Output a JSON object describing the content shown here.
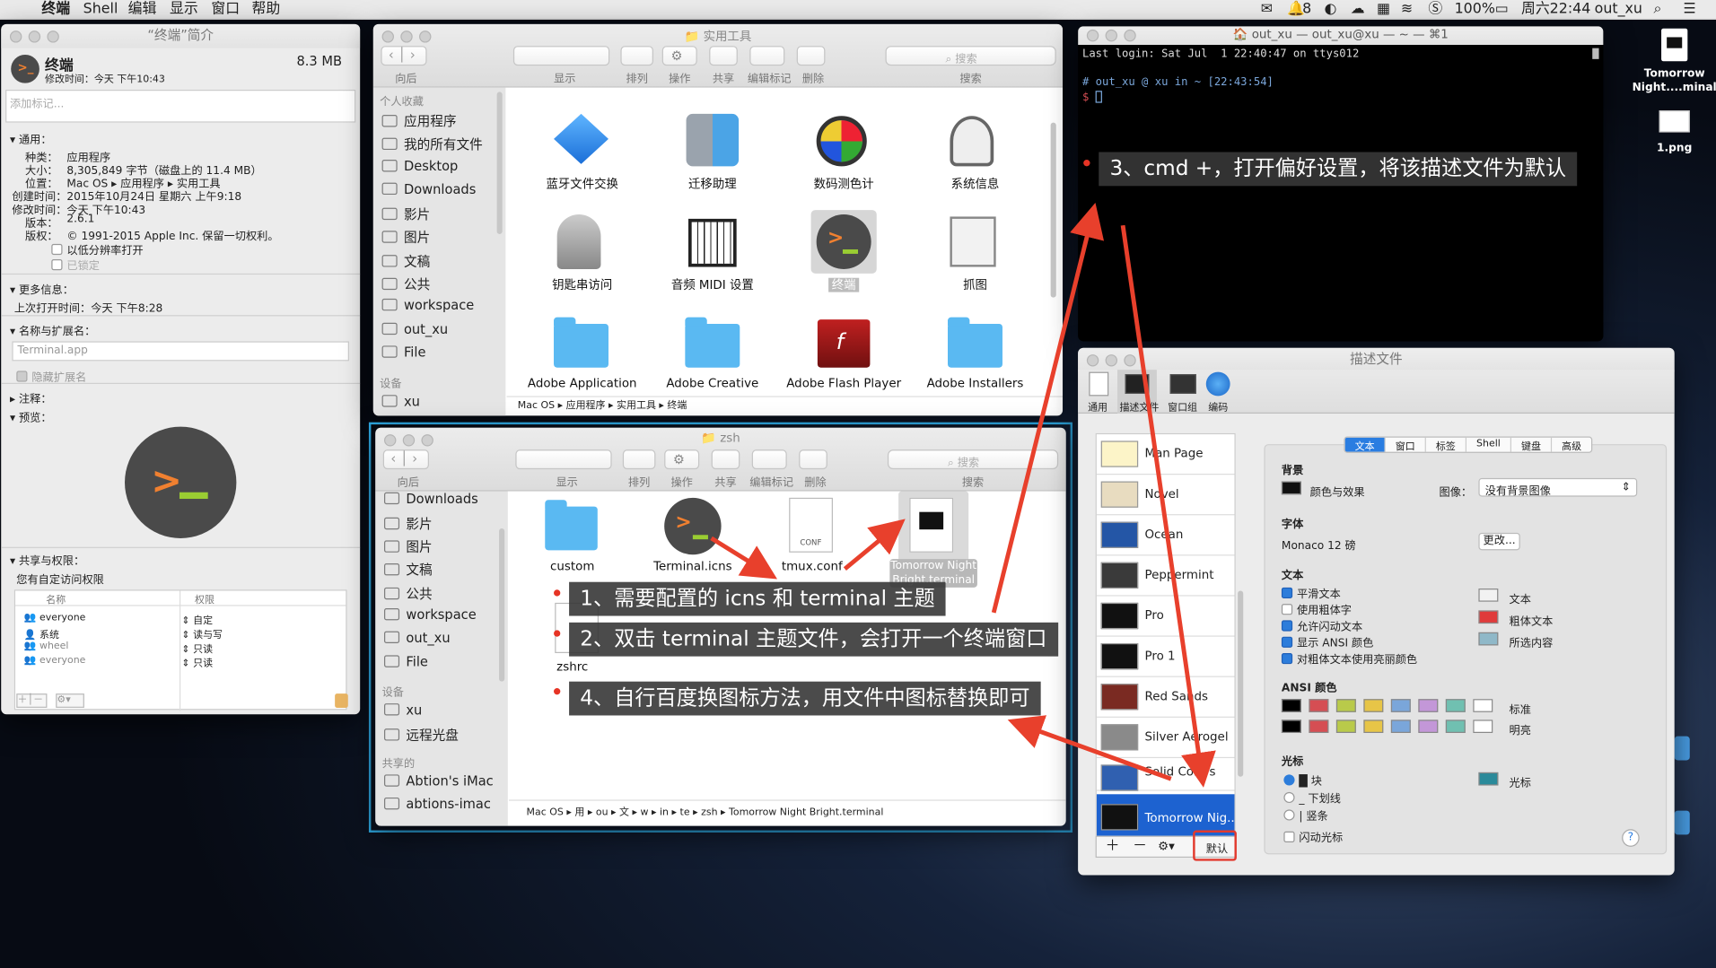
{
  "menubar": {
    "app": "终端",
    "items": [
      "Shell",
      "编辑",
      "显示",
      "窗口",
      "帮助"
    ],
    "wechat_badge": "8",
    "battery": "100%",
    "datetime": "周六22:44",
    "user": "out_xu"
  },
  "desktop": {
    "icons": [
      {
        "label": "Tomorrow Night....minal"
      },
      {
        "label": "1.png"
      }
    ]
  },
  "info": {
    "title": "“终端”简介",
    "name": "终端",
    "size": "8.3 MB",
    "modified": "修改时间：今天 下午10:43",
    "tags_placeholder": "添加标记...",
    "general_hd": "通用：",
    "rows": [
      {
        "k": "种类：",
        "v": "应用程序"
      },
      {
        "k": "大小：",
        "v": "8,305,849 字节（磁盘上的 11.4 MB）"
      },
      {
        "k": "位置：",
        "v": "Mac OS ▸ 应用程序 ▸ 实用工具"
      },
      {
        "k": "创建时间：",
        "v": "2015年10月24日 星期六 上午9:18"
      },
      {
        "k": "修改时间：",
        "v": "今天 下午10:43"
      },
      {
        "k": "版本：",
        "v": "2.6.1"
      },
      {
        "k": "版权：",
        "v": "© 1991-2015 Apple Inc. 保留一切权利。"
      }
    ],
    "lowres": "以低分辨率打开",
    "locked": "已锁定",
    "more_hd": "更多信息：",
    "last_opened": "上次打开时间：今天 下午8:28",
    "name_hd": "名称与扩展名：",
    "filename": "Terminal.app",
    "hide_ext": "隐藏扩展名",
    "comments_hd": "注释：",
    "preview_hd": "预览：",
    "share_hd": "共享与权限：",
    "custom_access": "您有自定访问权限",
    "perm_headers": [
      "名称",
      "权限"
    ],
    "perms": [
      {
        "n": "everyone",
        "p": "自定"
      },
      {
        "n": "系统",
        "p": "读与写"
      },
      {
        "n": "wheel",
        "p": "只读"
      },
      {
        "n": "everyone",
        "p": "只读"
      }
    ]
  },
  "finder_tb": {
    "back": "向后",
    "view": "显示",
    "arrange": "排列",
    "action": "操作",
    "share": "共享",
    "tags": "编辑标记",
    "delete": "删除",
    "search_ph": "搜索",
    "search": "搜索"
  },
  "finder1": {
    "title": "实用工具",
    "sec_fav": "个人收藏",
    "sidebar": [
      "应用程序",
      "我的所有文件",
      "Desktop",
      "Downloads",
      "影片",
      "图片",
      "文稿",
      "公共",
      "workspace",
      "out_xu",
      "File"
    ],
    "sec_dev": "设备",
    "device": "xu",
    "items": [
      "蓝牙文件交换",
      "迁移助理",
      "数码测色计",
      "系统信息",
      "钥匙串访问",
      "音频 MIDI 设置",
      "终端",
      "抓图",
      "Adobe Application",
      "Adobe Creative",
      "Adobe Flash Player",
      "Adobe Installers"
    ],
    "path": [
      "Mac OS",
      "应用程序",
      "实用工具",
      "终端"
    ]
  },
  "finder2": {
    "title": "zsh",
    "sidebar": [
      "Downloads",
      "影片",
      "图片",
      "文稿",
      "公共",
      "workspace",
      "out_xu",
      "File"
    ],
    "sec_dev": "设备",
    "devices": [
      "xu",
      "远程光盘"
    ],
    "sec_shared": "共享的",
    "shared": [
      "Abtion's iMac",
      "abtions-imac"
    ],
    "items": [
      "custom",
      "Terminal.icns",
      "tmux.conf",
      "Tomorrow Night Bright.terminal",
      "zshrc"
    ],
    "conf_badge": "CONF",
    "path": [
      "Mac OS",
      "用",
      "ou",
      "文",
      "w",
      "in",
      "te",
      "zsh",
      "Tomorrow Night Bright.terminal"
    ]
  },
  "terminal": {
    "title": "out_xu — out_xu@xu — ~ — ⌘1",
    "line1": "Last login: Sat Jul  1 22:40:47 on ttys012",
    "line2": "# out_xu @ xu in ~ [22:43:54]",
    "prompt": "$"
  },
  "notes": [
    "1、需要配置的 icns 和 terminal 主题",
    "2、双击 terminal 主题文件，会打开一个终端窗口",
    "3、cmd +，打开偏好设置，将该描述文件为默认",
    "4、自行百度换图标方法，用文件中图标替换即可"
  ],
  "prefs": {
    "title": "描述文件",
    "tabs": [
      "通用",
      "描述文件",
      "窗口组",
      "编码"
    ],
    "profiles": [
      "Man Page",
      "Novel",
      "Ocean",
      "Peppermint",
      "Pro",
      "Pro 1",
      "Red Sands",
      "Silver Aerogel",
      "Solid Colors",
      "Tomorrow Nig..."
    ],
    "default_btn": "默认",
    "seg": [
      "文本",
      "窗口",
      "标签",
      "Shell",
      "键盘",
      "高级"
    ],
    "bg_hd": "背景",
    "bg_color": "颜色与效果",
    "image_lbl": "图像：",
    "image_val": "没有背景图像",
    "font_hd": "字体",
    "font": "Monaco 12 磅",
    "change": "更改...",
    "text_hd": "文本",
    "text_opts": [
      {
        "l": "平滑文本",
        "on": true
      },
      {
        "l": "使用粗体字",
        "on": false
      },
      {
        "l": "允许闪动文本",
        "on": true
      },
      {
        "l": "显示 ANSI 颜色",
        "on": true
      },
      {
        "l": "对粗体文本使用亮丽颜色",
        "on": true
      }
    ],
    "text_colors": [
      "文本",
      "粗体文本",
      "所选内容"
    ],
    "ansi_hd": "ANSI 颜色",
    "ansi_normal": "标准",
    "ansi_bright": "明亮",
    "ansi_colors": [
      "#000000",
      "#d54e53",
      "#b9ca4a",
      "#e7c547",
      "#7aa6da",
      "#c397d8",
      "#70c0b1",
      "#ffffff"
    ],
    "cursor_hd": "光标",
    "cursor_opts": [
      "块",
      "下划线",
      "竖条"
    ],
    "cursor_color": "光标",
    "blink": "闪动光标",
    "help": "?"
  }
}
